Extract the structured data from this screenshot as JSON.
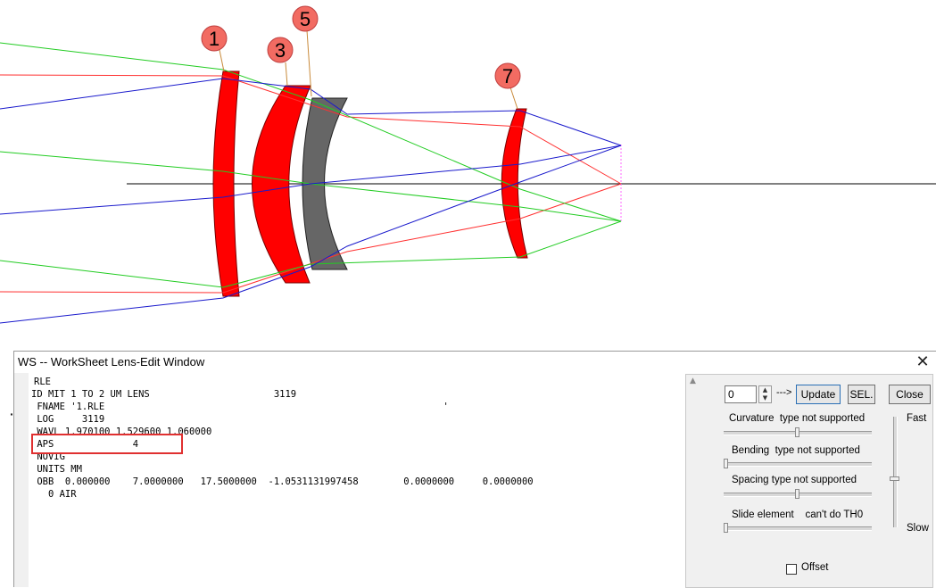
{
  "colors": {
    "lens_red": "#ff0000",
    "lens_gray": "#666666",
    "ray_red": "#ff3030",
    "ray_green": "#22cc22",
    "ray_blue": "#1a1acc",
    "bubble_fill": "#f26b62",
    "highlight_red": "#e03030"
  },
  "diagram": {
    "element_labels": [
      "1",
      "3",
      "5",
      "7"
    ]
  },
  "window": {
    "title": "WS -- WorkSheet Lens-Edit Window",
    "close_icon": "close-icon"
  },
  "editor": {
    "lines": [
      "RLE",
      "ID MIT 1 TO 2 UM LENS                      3119",
      " FNAME '1.RLE                                                            '",
      " LOG     3119",
      " WAVL 1.970100 1.529600 1.060000",
      " APS              4",
      " NOVIG",
      " UNITS MM",
      " OBB  0.000000    7.0000000   17.5000000  -1.0531131997458        0.0000000     0.0000000",
      "   0 AIR"
    ]
  },
  "controls": {
    "spin_value": "0",
    "arrow_label": "--->",
    "update_label": "Update",
    "sel_label": "SEL.",
    "close_label": "Close",
    "curvature_label": "Curvature  type not supported",
    "bending_label": "Bending  type not supported",
    "spacing_label": "Spacing type not supported",
    "slide_label": "Slide element    can't do TH0",
    "fast_label": "Fast",
    "slow_label": "Slow",
    "offset_label": "Offset"
  }
}
